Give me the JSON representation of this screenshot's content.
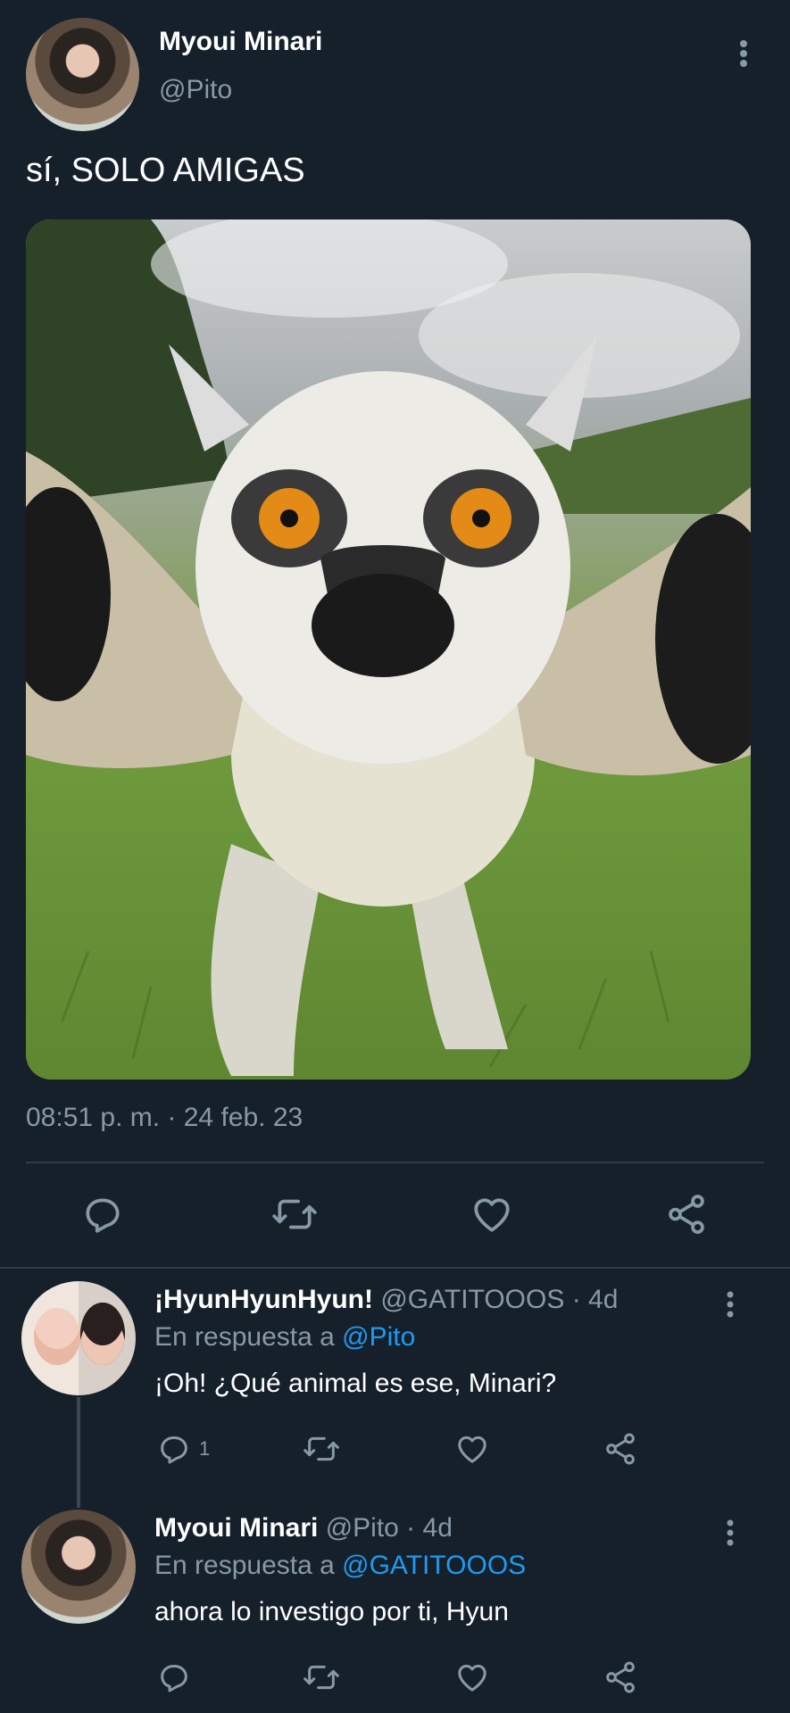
{
  "tweet": {
    "author_name": "Myoui Minari",
    "author_handle": "@Pito",
    "text": "sí, SOLO AMIGAS",
    "timestamp": "08:51 p. m. · 24 feb. 23",
    "icons": {
      "more": "more-vertical-icon",
      "reply": "reply-icon",
      "retweet": "retweet-icon",
      "like": "heart-icon",
      "share": "share-icon"
    }
  },
  "replies": [
    {
      "name": "¡HyunHyunHyun!",
      "handle": "@GATITOOOS",
      "sep": " · ",
      "age": "4d",
      "replying_prefix": "En respuesta a ",
      "replying_to": "@Pito",
      "text": "¡Oh! ¿Qué animal es ese, Minari?",
      "reply_count": "1"
    },
    {
      "name": "Myoui Minari",
      "handle": "@Pito",
      "sep": " · ",
      "age": "4d",
      "replying_prefix": "En respuesta a ",
      "replying_to": "@GATITOOOS",
      "text": "ahora lo investigo por ti, Hyun",
      "reply_count": ""
    }
  ],
  "colors": {
    "background": "#15202b",
    "muted_text": "#8899a6",
    "link": "#1d9bf0",
    "divider": "#2f3b47"
  }
}
